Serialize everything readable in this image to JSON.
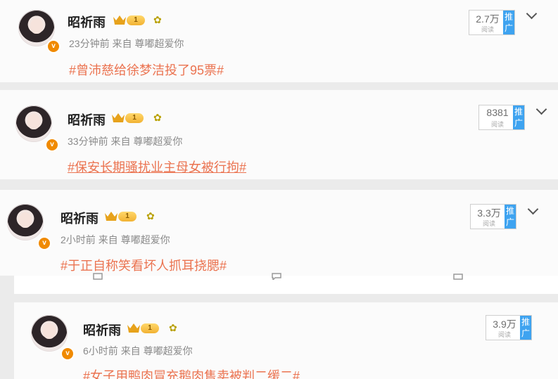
{
  "posts": [
    {
      "author": "昭祈雨",
      "level": "1",
      "time": "23分钟前",
      "source_prefix": "来自",
      "source": "尊嘟超爱你",
      "topic": "#曾沛慈给徐梦洁投了95票#",
      "reads": "2.7万",
      "reads_label": "阅读",
      "promote": "推广"
    },
    {
      "author": "昭祈雨",
      "level": "1",
      "time": "33分钟前",
      "source_prefix": "来自",
      "source": "尊嘟超爱你",
      "topic": "#保安长期骚扰业主母女被行拘#",
      "reads": "8381",
      "reads_label": "阅读",
      "promote": "推广"
    },
    {
      "author": "昭祈雨",
      "level": "1",
      "time": "2小时前",
      "source_prefix": "来自",
      "source": "尊嘟超爱你",
      "topic": "#于正自称笑看坏人抓耳挠腮#",
      "reads": "3.3万",
      "reads_label": "阅读",
      "promote": "推广"
    },
    {
      "author": "昭祈雨",
      "level": "1",
      "time": "6小时前",
      "source_prefix": "来自",
      "source": "尊嘟超爱你",
      "topic": "#女子用鸭肉冒充鹅肉售卖被判二缓二#",
      "reads": "3.9万",
      "reads_label": "阅读",
      "promote": "推广"
    }
  ],
  "icons": {
    "verified": "v-badge-icon",
    "crown": "crown-icon",
    "flower": "flower-icon",
    "more": "chevron-down-icon"
  },
  "colors": {
    "topic": "#eb7350",
    "promote": "#3ea3f0",
    "verified": "#f08a00"
  }
}
